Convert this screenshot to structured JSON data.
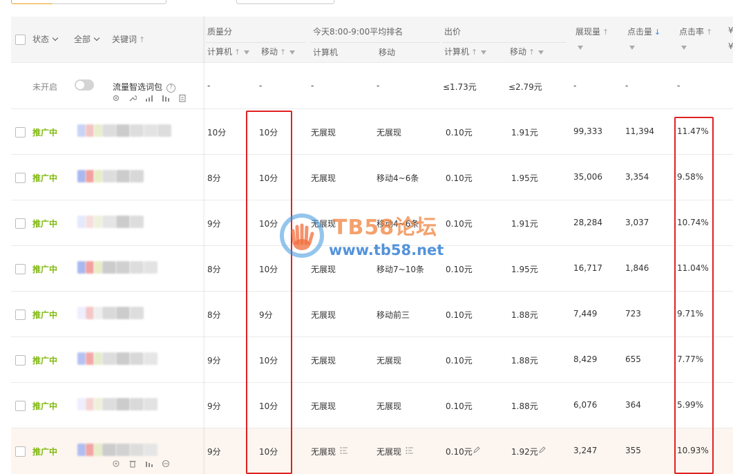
{
  "header": {
    "status": "状态",
    "all": "全部",
    "keyword": "关键词",
    "quality": "质量分",
    "rank": "今天8:00-9:00平均排名",
    "bid": "出价",
    "impressions": "展现量",
    "clicks": "点击量",
    "ctr": "点击率",
    "computer": "计算机",
    "mobile": "移动",
    "right_clip_top": "¥",
    "right_clip_bottom": "¥"
  },
  "bundle_row": {
    "status": "未开启",
    "name": "流量智选词包",
    "q_pc": "-",
    "q_mobile": "-",
    "rank_pc": "-",
    "rank_mobile": "-",
    "bid_pc": "≤1.73元",
    "bid_mobile": "≤2.79元",
    "impressions": "-",
    "clicks": "-",
    "ctr": "-"
  },
  "rows": [
    {
      "status": "推广中",
      "q_pc": "10分",
      "q_mobile": "10分",
      "rank_pc": "无展现",
      "rank_mobile": "无展现",
      "bid_pc": "0.10元",
      "bid_mobile": "1.91元",
      "impressions": "99,333",
      "clicks": "11,394",
      "ctr": "11.47%"
    },
    {
      "status": "推广中",
      "q_pc": "8分",
      "q_mobile": "10分",
      "rank_pc": "无展现",
      "rank_mobile": "移动4~6条",
      "bid_pc": "0.10元",
      "bid_mobile": "1.95元",
      "impressions": "35,006",
      "clicks": "3,354",
      "ctr": "9.58%"
    },
    {
      "status": "推广中",
      "q_pc": "9分",
      "q_mobile": "10分",
      "rank_pc": "无展现",
      "rank_mobile": "移动4~6条",
      "bid_pc": "0.10元",
      "bid_mobile": "1.91元",
      "impressions": "28,284",
      "clicks": "3,037",
      "ctr": "10.74%"
    },
    {
      "status": "推广中",
      "q_pc": "8分",
      "q_mobile": "10分",
      "rank_pc": "无展现",
      "rank_mobile": "移动7~10条",
      "bid_pc": "0.10元",
      "bid_mobile": "1.95元",
      "impressions": "16,717",
      "clicks": "1,846",
      "ctr": "11.04%"
    },
    {
      "status": "推广中",
      "q_pc": "8分",
      "q_mobile": "9分",
      "rank_pc": "无展现",
      "rank_mobile": "移动前三",
      "bid_pc": "0.10元",
      "bid_mobile": "1.88元",
      "impressions": "7,449",
      "clicks": "723",
      "ctr": "9.71%"
    },
    {
      "status": "推广中",
      "q_pc": "9分",
      "q_mobile": "10分",
      "rank_pc": "无展现",
      "rank_mobile": "无展现",
      "bid_pc": "0.10元",
      "bid_mobile": "1.88元",
      "impressions": "8,429",
      "clicks": "655",
      "ctr": "7.77%"
    },
    {
      "status": "推广中",
      "q_pc": "9分",
      "q_mobile": "10分",
      "rank_pc": "无展现",
      "rank_mobile": "无展现",
      "bid_pc": "0.10元",
      "bid_mobile": "1.88元",
      "impressions": "6,076",
      "clicks": "364",
      "ctr": "5.99%"
    },
    {
      "status": "推广中",
      "q_pc": "9分",
      "q_mobile": "10分",
      "rank_pc": "无展现",
      "rank_mobile": "无展现",
      "bid_pc": "0.10元",
      "bid_mobile": "1.92元",
      "impressions": "3,247",
      "clicks": "355",
      "ctr": "10.93%"
    }
  ],
  "watermark": {
    "title": "TB58论坛",
    "url": "www.tb58.net"
  },
  "colors": {
    "status_active": "#7fb80e",
    "highlight_box": "#e02020",
    "sort_active": "#3a7de0",
    "hover_row": "#fdf6f0"
  }
}
